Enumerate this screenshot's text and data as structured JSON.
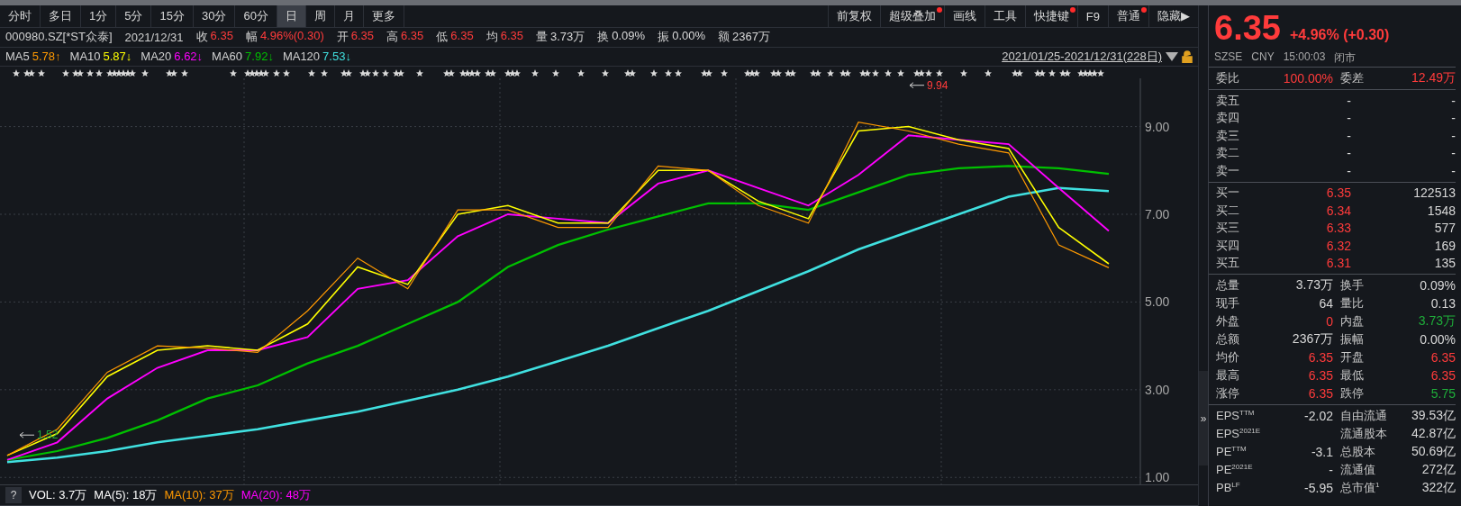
{
  "tabs": [
    {
      "label": "分时",
      "selected": false
    },
    {
      "label": "多日",
      "selected": false
    },
    {
      "label": "1分",
      "selected": false
    },
    {
      "label": "5分",
      "selected": false
    },
    {
      "label": "15分",
      "selected": false
    },
    {
      "label": "30分",
      "selected": false
    },
    {
      "label": "60分",
      "selected": false
    },
    {
      "label": "日",
      "selected": true
    },
    {
      "label": "周",
      "selected": false
    },
    {
      "label": "月",
      "selected": false
    },
    {
      "label": "更多",
      "selected": false
    }
  ],
  "tools": [
    {
      "label": "前复权",
      "dot": false
    },
    {
      "label": "超级叠加",
      "dot": true
    },
    {
      "label": "画线",
      "dot": false
    },
    {
      "label": "工具",
      "dot": false
    },
    {
      "label": "快捷键",
      "dot": true
    },
    {
      "label": "F9",
      "dot": false
    },
    {
      "label": "普通",
      "dot": true
    },
    {
      "label": "隐藏▶",
      "dot": false
    }
  ],
  "quote_bar": {
    "code": "000980.SZ[*ST众泰]",
    "date": "2021/12/31",
    "fields": [
      {
        "label": "收",
        "value": "6.35",
        "color": "#ff3b3b"
      },
      {
        "label": "幅",
        "value": "4.96%(0.30)",
        "color": "#ff3b3b"
      },
      {
        "label": "开",
        "value": "6.35",
        "color": "#ff3b3b"
      },
      {
        "label": "高",
        "value": "6.35",
        "color": "#ff3b3b"
      },
      {
        "label": "低",
        "value": "6.35",
        "color": "#ff3b3b"
      },
      {
        "label": "均",
        "value": "6.35",
        "color": "#ff3b3b"
      },
      {
        "label": "量",
        "value": "3.73万",
        "color": "#d8d8d8"
      },
      {
        "label": "换",
        "value": "0.09%",
        "color": "#d8d8d8"
      },
      {
        "label": "振",
        "value": "0.00%",
        "color": "#d8d8d8"
      },
      {
        "label": "额",
        "value": "2367万",
        "color": "#d8d8d8"
      }
    ]
  },
  "ma_legend": [
    {
      "label": "MA5",
      "value": "5.78↑",
      "color": "#ff9900"
    },
    {
      "label": "MA10",
      "value": "5.87↓",
      "color": "#ffff00"
    },
    {
      "label": "MA20",
      "value": "6.62↓",
      "color": "#ff00ff"
    },
    {
      "label": "MA60",
      "value": "7.92↓",
      "color": "#00c000"
    },
    {
      "label": "MA120",
      "value": "7.53↓",
      "color": "#40e0e0"
    }
  ],
  "date_range": "2021/01/25-2021/12/31(228日)",
  "chart_data": {
    "type": "line",
    "grid": true,
    "ylim": [
      0.8,
      10.1
    ],
    "yticks": [
      {
        "value": 9,
        "label": "9.00"
      },
      {
        "value": 7,
        "label": "7.00"
      },
      {
        "value": 5,
        "label": "5.00"
      },
      {
        "value": 3,
        "label": "3.00"
      },
      {
        "value": 1,
        "label": "1.00"
      }
    ],
    "series": [
      {
        "color": "#40e0e0",
        "values": [
          1.35,
          1.45,
          1.6,
          1.8,
          1.95,
          2.1,
          2.3,
          2.5,
          2.75,
          3.0,
          3.3,
          3.65,
          4.0,
          4.4,
          4.8,
          5.25,
          5.7,
          6.2,
          6.6,
          7.0,
          7.4,
          7.6,
          7.53
        ]
      },
      {
        "color": "#00c000",
        "values": [
          1.4,
          1.6,
          1.9,
          2.3,
          2.8,
          3.1,
          3.6,
          4.0,
          4.5,
          5.0,
          5.8,
          6.3,
          6.65,
          6.95,
          7.25,
          7.25,
          7.1,
          7.5,
          7.9,
          8.05,
          8.1,
          8.05,
          7.92
        ]
      },
      {
        "color": "#ff00ff",
        "values": [
          1.4,
          1.8,
          2.8,
          3.5,
          3.9,
          3.9,
          4.2,
          5.3,
          5.5,
          6.5,
          7.0,
          6.9,
          6.8,
          7.7,
          8.0,
          7.6,
          7.2,
          7.9,
          8.8,
          8.7,
          8.6,
          7.6,
          6.62
        ]
      },
      {
        "color": "#ffff00",
        "values": [
          1.5,
          2.0,
          3.3,
          3.9,
          4.0,
          3.9,
          4.5,
          5.8,
          5.4,
          7.0,
          7.2,
          6.8,
          6.8,
          8.0,
          8.0,
          7.3,
          6.9,
          8.9,
          9.0,
          8.7,
          8.5,
          6.7,
          5.87
        ]
      },
      {
        "color": "#ff9900",
        "values": [
          1.5,
          2.1,
          3.4,
          4.0,
          3.95,
          3.85,
          4.8,
          6.0,
          5.3,
          7.1,
          7.1,
          6.7,
          6.7,
          8.1,
          8.0,
          7.2,
          6.8,
          9.1,
          8.9,
          8.6,
          8.4,
          6.3,
          5.78
        ]
      }
    ],
    "annotations": [
      {
        "text": "9.94"
      },
      {
        "text": "1.52"
      }
    ]
  },
  "volume_bar": {
    "help": "?",
    "items": [
      {
        "text": "VOL: 3.7万",
        "color": "#ffffff"
      },
      {
        "text": "MA(5): 18万",
        "color": "#ffffff"
      },
      {
        "text": "MA(10): 37万",
        "color": "#ff9900"
      },
      {
        "text": "MA(20): 48万",
        "color": "#ff00ff"
      }
    ]
  },
  "side_toggle": "»",
  "quote_panel": {
    "price": "6.35",
    "change": "+4.96% (+0.30)",
    "color": "#ff3b3b",
    "meta": [
      "SZSE",
      "CNY",
      "15:00:03",
      "闭市"
    ],
    "ratio": [
      {
        "label": "委比",
        "value": "100.00%"
      },
      {
        "label": "委差",
        "value": "12.49万"
      }
    ],
    "asks": [
      {
        "label": "卖五",
        "price": "-",
        "volume": "-"
      },
      {
        "label": "卖四",
        "price": "-",
        "volume": "-"
      },
      {
        "label": "卖三",
        "price": "-",
        "volume": "-"
      },
      {
        "label": "卖二",
        "price": "-",
        "volume": "-"
      },
      {
        "label": "卖一",
        "price": "-",
        "volume": "-"
      }
    ],
    "bids": [
      {
        "label": "买一",
        "price": "6.35",
        "volume": "122513",
        "color": "#ff3b3b"
      },
      {
        "label": "买二",
        "price": "6.34",
        "volume": "1548",
        "color": "#ff3b3b"
      },
      {
        "label": "买三",
        "price": "6.33",
        "volume": "577",
        "color": "#ff3b3b"
      },
      {
        "label": "买四",
        "price": "6.32",
        "volume": "169",
        "color": "#ff3b3b"
      },
      {
        "label": "买五",
        "price": "6.31",
        "volume": "135",
        "color": "#ff3b3b"
      }
    ],
    "stats": [
      {
        "label": "总量",
        "value": "3.73万",
        "color": "#d8d8d8"
      },
      {
        "label": "换手",
        "value": "0.09%",
        "color": "#d8d8d8"
      },
      {
        "label": "现手",
        "value": "64",
        "color": "#d8d8d8"
      },
      {
        "label": "量比",
        "value": "0.13",
        "color": "#d8d8d8"
      },
      {
        "label": "外盘",
        "value": "0",
        "color": "#ff3b3b"
      },
      {
        "label": "内盘",
        "value": "3.73万",
        "color": "#1fae3a"
      },
      {
        "label": "总额",
        "value": "2367万",
        "color": "#d8d8d8"
      },
      {
        "label": "振幅",
        "value": "0.00%",
        "color": "#d8d8d8"
      },
      {
        "label": "均价",
        "value": "6.35",
        "color": "#ff3b3b"
      },
      {
        "label": "开盘",
        "value": "6.35",
        "color": "#ff3b3b"
      },
      {
        "label": "最高",
        "value": "6.35",
        "color": "#ff3b3b"
      },
      {
        "label": "最低",
        "value": "6.35",
        "color": "#ff3b3b"
      },
      {
        "label": "涨停",
        "value": "6.35",
        "color": "#ff3b3b"
      },
      {
        "label": "跌停",
        "value": "5.75",
        "color": "#1fae3a"
      }
    ],
    "fundamentals": [
      {
        "label": "EPS$^{TTM}$",
        "value": "-2.02"
      },
      {
        "label": "自由流通",
        "value": "39.53亿"
      },
      {
        "label": "EPS$^{2021E}$"
      },
      {
        "label": "流通股本",
        "value": "42.87亿"
      },
      {
        "label": "PE$^{TTM}$",
        "value": "-3.1"
      },
      {
        "label": "总股本",
        "value": "50.69亿"
      },
      {
        "label": "PE$^{2021E}$",
        "value": "-"
      },
      {
        "label": "流通值",
        "value": "272亿"
      },
      {
        "label": "PB$^{LF}$",
        "value": "-5.95"
      },
      {
        "label": "总市值$^{1}$",
        "value": "322亿"
      }
    ]
  }
}
